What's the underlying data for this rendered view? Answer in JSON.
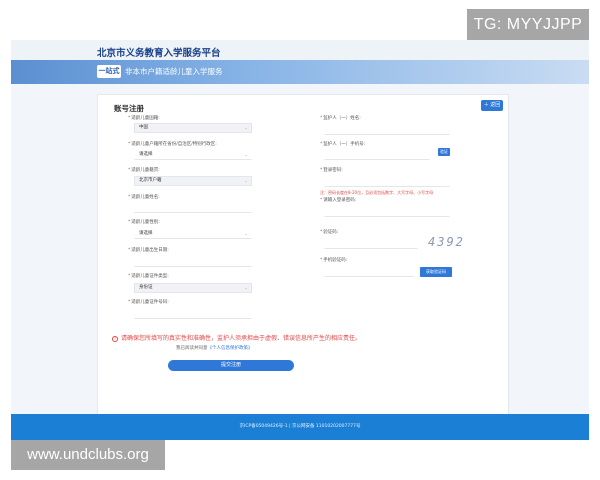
{
  "watermarks": {
    "top_right": "TG: MYYJJPP",
    "bottom_left": "www.undclubs.org"
  },
  "header": {
    "portal_title": "北京市义务教育入学服务平台"
  },
  "banner": {
    "logo_text": "一站式",
    "service_name": "非本市户籍适龄儿童入学服务"
  },
  "card": {
    "title": "账号注册",
    "back_button": "＋ 返回",
    "left_fields": [
      {
        "label": "适龄儿童国籍:",
        "value": "中国",
        "select": true
      },
      {
        "label": "适龄儿童户籍所在省份/自治区/特别行政区:",
        "value": "请选择",
        "select": true
      },
      {
        "label": "适龄儿童籍贯:",
        "value": "北京市户籍",
        "select": true
      },
      {
        "label": "适龄儿童姓名:",
        "value": "",
        "select": false
      },
      {
        "label": "适龄儿童性别:",
        "value": "请选择",
        "select": true
      },
      {
        "label": "适龄儿童出生日期:",
        "value": "",
        "select": false
      },
      {
        "label": "适龄儿童证件类型:",
        "value": "身份证",
        "select": true
      },
      {
        "label": "适龄儿童证件号码:",
        "value": "",
        "select": false
      }
    ],
    "right_fields": {
      "guardian_name_label": "监护人（一）姓名:",
      "guardian_phone_label": "监护人（一）手机号:",
      "phone_button": "验证",
      "password_label": "登录密码:",
      "password_hint": "注：密码长度在8-20位，且必须包括数字、大写字母、小写字母",
      "confirm_label": "请输入登录密码:",
      "captcha_label": "验证码:",
      "captcha_value": "4392",
      "sms_label": "手机验证码:",
      "sms_button": "获取验证码"
    },
    "notice": "请确保您所填写的真实性和准确性，监护人须承担由于虚假、错误信息所产生的相应责任。",
    "notice_icon": "!",
    "agree_prefix": "我已阅读并同意",
    "agree_link": "《个人信息保护政策》",
    "submit": "提交注册"
  },
  "footer": {
    "text": "京ICP备05049426号-1 | 京公网安备 11010202007777号"
  }
}
